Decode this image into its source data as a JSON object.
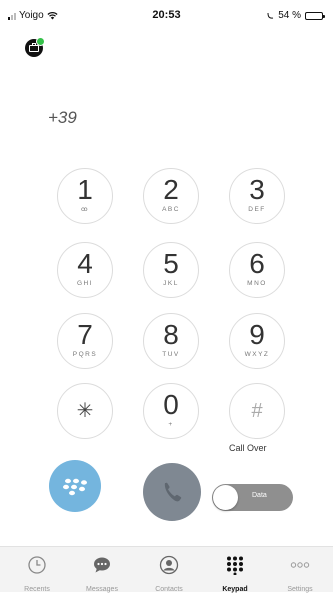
{
  "status_bar": {
    "carrier": "Yoigo",
    "time": "20:53",
    "battery": "54 %",
    "battery_level": 0.54
  },
  "dialer": {
    "number": "+39",
    "keys": [
      {
        "digit": "1",
        "letters": "ꝏ"
      },
      {
        "digit": "2",
        "letters": "ABC"
      },
      {
        "digit": "3",
        "letters": "DEF"
      },
      {
        "digit": "4",
        "letters": "GHI"
      },
      {
        "digit": "5",
        "letters": "JKL"
      },
      {
        "digit": "6",
        "letters": "MNO"
      },
      {
        "digit": "7",
        "letters": "PQRS"
      },
      {
        "digit": "8",
        "letters": "TUV"
      },
      {
        "digit": "9",
        "letters": "WXYZ"
      },
      {
        "digit": "✳",
        "letters": ""
      },
      {
        "digit": "0",
        "letters": "+"
      },
      {
        "digit": "#",
        "letters": ""
      }
    ]
  },
  "call_over": {
    "label": "Call Over",
    "toggle_text": "Data"
  },
  "tabs": [
    {
      "label": "Recents",
      "icon": "clock-icon"
    },
    {
      "label": "Messages",
      "icon": "chat-bubble-icon"
    },
    {
      "label": "Contacts",
      "icon": "contact-icon"
    },
    {
      "label": "Keypad",
      "icon": "keypad-icon",
      "active": true
    },
    {
      "label": "Settings",
      "icon": "more-dots-icon"
    }
  ],
  "colors": {
    "bb_button": "#74b5de",
    "call_button": "#7f8892",
    "toggle": "#8f8f8f",
    "active_tab": "#111111",
    "status_dot": "#35c14a"
  }
}
